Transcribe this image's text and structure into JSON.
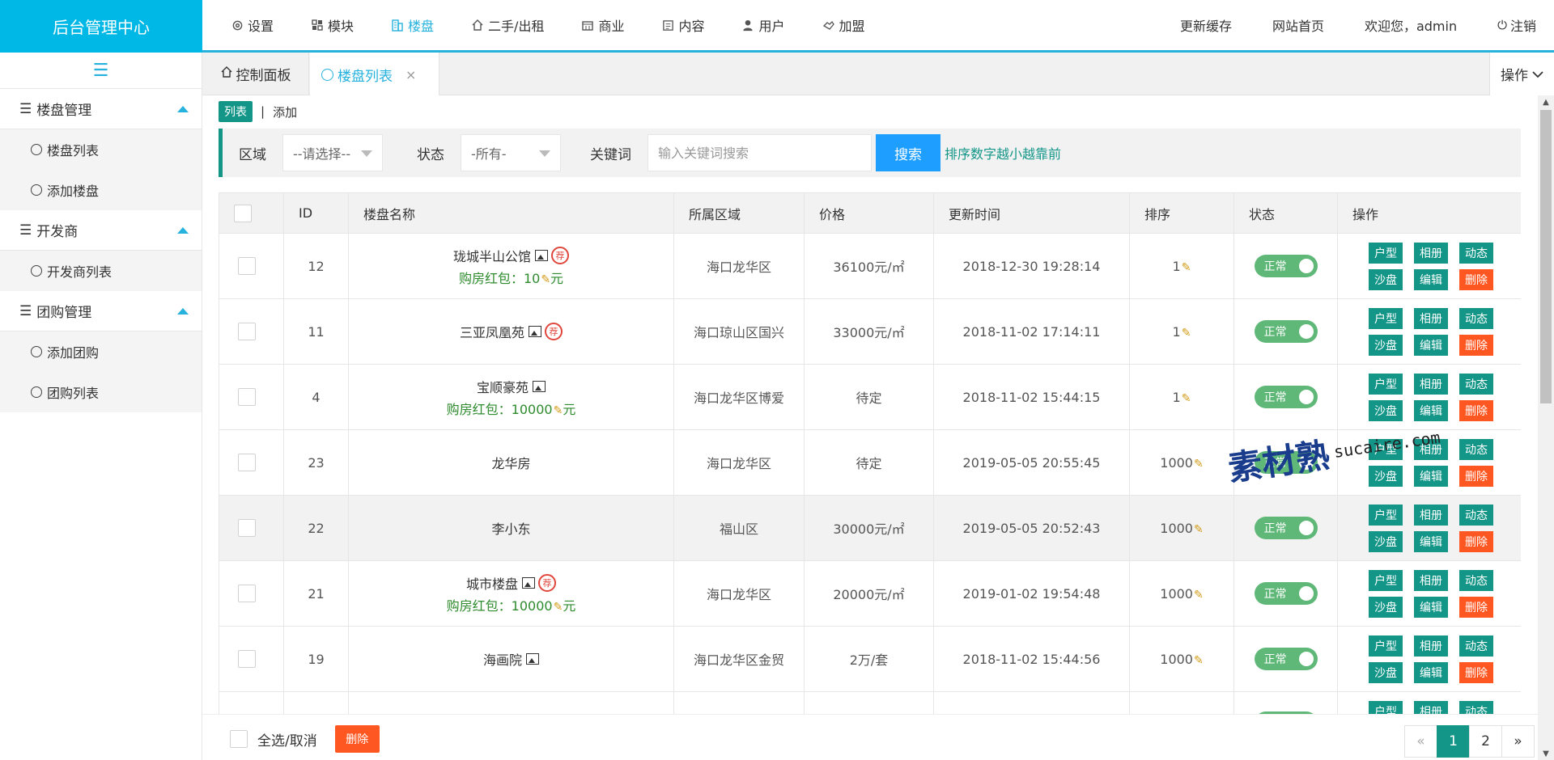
{
  "brand": "后台管理中心",
  "topnav": [
    {
      "label": "设置",
      "icon": "gear-icon",
      "active": false
    },
    {
      "label": "模块",
      "icon": "grid-icon",
      "active": false
    },
    {
      "label": "楼盘",
      "icon": "building-icon",
      "active": true
    },
    {
      "label": "二手/出租",
      "icon": "house-icon",
      "active": false
    },
    {
      "label": "商业",
      "icon": "shop-icon",
      "active": false
    },
    {
      "label": "内容",
      "icon": "document-icon",
      "active": false
    },
    {
      "label": "用户",
      "icon": "user-icon",
      "active": false
    },
    {
      "label": "加盟",
      "icon": "handshake-icon",
      "active": false
    }
  ],
  "topright": {
    "refresh_cache": "更新缓存",
    "site_home": "网站首页",
    "welcome": "欢迎您，admin",
    "logout": "注销"
  },
  "sidebar": {
    "groups": [
      {
        "title": "楼盘管理",
        "items": [
          "楼盘列表",
          "添加楼盘"
        ]
      },
      {
        "title": "开发商",
        "items": [
          "开发商列表"
        ]
      },
      {
        "title": "团购管理",
        "items": [
          "添加团购",
          "团购列表"
        ]
      }
    ]
  },
  "tabs": {
    "home": "控制面板",
    "current": "楼盘列表",
    "close": "×",
    "ops": "操作"
  },
  "subtabs": {
    "list": "列表",
    "add": "添加",
    "sep": "|"
  },
  "filter": {
    "area_label": "区域",
    "area_value": "--请选择--",
    "status_label": "状态",
    "status_value": "-所有-",
    "keyword_label": "关键词",
    "keyword_placeholder": "输入关键词搜索",
    "search_button": "搜索",
    "tip": "排序数字越小越靠前"
  },
  "table": {
    "headers": [
      "ID",
      "楼盘名称",
      "所属区域",
      "价格",
      "更新时间",
      "排序",
      "状态",
      "操作"
    ],
    "rows": [
      {
        "id": "12",
        "name": "珑城半山公馆",
        "image": true,
        "rec": true,
        "bonus": "购房红包：10",
        "bonus_unit": "元",
        "area": "海口龙华区",
        "price": "36100元/㎡",
        "time": "2018-12-30 19:28:14",
        "sort": "1",
        "status": "正常"
      },
      {
        "id": "11",
        "name": "三亚凤凰苑",
        "image": true,
        "rec": true,
        "bonus": "",
        "bonus_unit": "",
        "area": "海口琼山区国兴",
        "price": "33000元/㎡",
        "time": "2018-11-02 17:14:11",
        "sort": "1",
        "status": "正常"
      },
      {
        "id": "4",
        "name": "宝顺豪苑",
        "image": true,
        "rec": false,
        "bonus": "购房红包：10000",
        "bonus_unit": "元",
        "area": "海口龙华区博爱",
        "price": "待定",
        "time": "2018-11-02 15:44:15",
        "sort": "1",
        "status": "正常"
      },
      {
        "id": "23",
        "name": "龙华房",
        "image": false,
        "rec": false,
        "bonus": "",
        "bonus_unit": "",
        "area": "海口龙华区",
        "price": "待定",
        "time": "2019-05-05 20:55:45",
        "sort": "1000",
        "status": "正常"
      },
      {
        "id": "22",
        "name": "李小东",
        "image": false,
        "rec": false,
        "bonus": "",
        "bonus_unit": "",
        "area": "福山区",
        "price": "30000元/㎡",
        "time": "2019-05-05 20:52:43",
        "sort": "1000",
        "status": "正常",
        "highlight": true
      },
      {
        "id": "21",
        "name": "城市楼盘",
        "image": true,
        "rec": true,
        "bonus": "购房红包：10000",
        "bonus_unit": "元",
        "area": "海口龙华区",
        "price": "20000元/㎡",
        "time": "2019-01-02 19:54:48",
        "sort": "1000",
        "status": "正常"
      },
      {
        "id": "19",
        "name": "海画院",
        "image": true,
        "rec": false,
        "bonus": "",
        "bonus_unit": "",
        "area": "海口龙华区金贸",
        "price": "2万/套",
        "time": "2018-11-02 15:44:56",
        "sort": "1000",
        "status": "正常"
      },
      {
        "id": "",
        "name": "",
        "image": false,
        "rec": true,
        "bonus": "",
        "bonus_unit": "",
        "area": "",
        "price": "",
        "time": "",
        "sort": "",
        "status": "",
        "partial": true
      }
    ],
    "row_actions": [
      "户型",
      "相册",
      "动态",
      "沙盘",
      "编辑",
      "删除"
    ],
    "rec_label": "荐"
  },
  "footer": {
    "select_all": "全选/取消",
    "delete_button": "删除",
    "pager": {
      "prev": "«",
      "pages": [
        "1",
        "2"
      ],
      "current": "1",
      "next": "»"
    }
  },
  "watermark": {
    "brand": "素材熟",
    "domain": "sucaire.com"
  },
  "colors": {
    "accent": "#00b8e6",
    "primary": "#139688",
    "danger": "#ff5722",
    "toggle_on": "#5fb878",
    "search": "#1e9fff"
  }
}
